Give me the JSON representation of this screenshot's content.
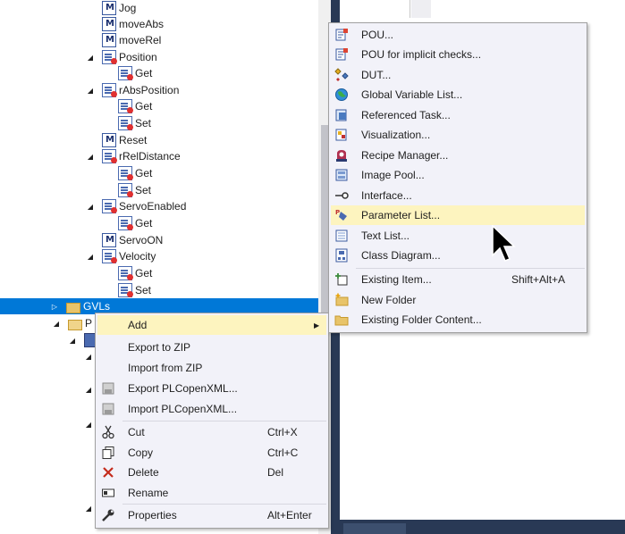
{
  "tree": {
    "items": [
      {
        "label": "Jog",
        "icon": "function-block-icon",
        "arrow": ""
      },
      {
        "label": "moveAbs",
        "icon": "function-block-icon",
        "arrow": ""
      },
      {
        "label": "moveRel",
        "icon": "function-block-icon",
        "arrow": ""
      },
      {
        "label": "Position",
        "icon": "property-icon",
        "arrow": "◢"
      },
      {
        "label": "Get",
        "icon": "property-icon",
        "arrow": ""
      },
      {
        "label": "rAbsPosition",
        "icon": "property-icon",
        "arrow": "◢"
      },
      {
        "label": "Get",
        "icon": "property-icon",
        "arrow": ""
      },
      {
        "label": "Set",
        "icon": "property-icon",
        "arrow": ""
      },
      {
        "label": "Reset",
        "icon": "function-block-icon",
        "arrow": ""
      },
      {
        "label": "rRelDistance",
        "icon": "property-icon",
        "arrow": "◢"
      },
      {
        "label": "Get",
        "icon": "property-icon",
        "arrow": ""
      },
      {
        "label": "Set",
        "icon": "property-icon",
        "arrow": ""
      },
      {
        "label": "ServoEnabled",
        "icon": "property-icon",
        "arrow": "◢"
      },
      {
        "label": "Get",
        "icon": "property-icon",
        "arrow": ""
      },
      {
        "label": "ServoON",
        "icon": "function-block-icon",
        "arrow": ""
      },
      {
        "label": "Velocity",
        "icon": "property-icon",
        "arrow": "◢"
      },
      {
        "label": "Get",
        "icon": "property-icon",
        "arrow": ""
      },
      {
        "label": "Set",
        "icon": "property-icon",
        "arrow": ""
      },
      {
        "label": "GVLs",
        "icon": "folder-icon",
        "arrow": "▷"
      },
      {
        "label": "P",
        "icon": "folder-open-icon",
        "arrow": "◢"
      }
    ]
  },
  "context_menu": {
    "items": [
      {
        "label": "Add",
        "icon": "",
        "shortcut": "",
        "submenu": "▶"
      },
      {
        "label": "Export to ZIP",
        "icon": "",
        "shortcut": ""
      },
      {
        "label": "Import from ZIP",
        "icon": "",
        "shortcut": ""
      },
      {
        "label": "Export PLCopenXML...",
        "icon": "export-xml-icon",
        "shortcut": ""
      },
      {
        "label": "Import PLCopenXML...",
        "icon": "import-xml-icon",
        "shortcut": ""
      },
      {
        "label": "Cut",
        "icon": "scissors-icon",
        "shortcut": "Ctrl+X"
      },
      {
        "label": "Copy",
        "icon": "copy-icon",
        "shortcut": "Ctrl+C"
      },
      {
        "label": "Delete",
        "icon": "delete-x-icon",
        "shortcut": "Del"
      },
      {
        "label": "Rename",
        "icon": "rename-icon",
        "shortcut": ""
      },
      {
        "label": "Properties",
        "icon": "wrench-icon",
        "shortcut": "Alt+Enter"
      }
    ]
  },
  "add_submenu": {
    "items": [
      {
        "label": "POU...",
        "icon": "pou-icon",
        "shortcut": ""
      },
      {
        "label": "POU for implicit checks...",
        "icon": "pou-checks-icon",
        "shortcut": ""
      },
      {
        "label": "DUT...",
        "icon": "dut-icon",
        "shortcut": ""
      },
      {
        "label": "Global Variable List...",
        "icon": "globe-icon",
        "shortcut": ""
      },
      {
        "label": "Referenced Task...",
        "icon": "referenced-task-icon",
        "shortcut": ""
      },
      {
        "label": "Visualization...",
        "icon": "visualization-icon",
        "shortcut": ""
      },
      {
        "label": "Recipe Manager...",
        "icon": "recipe-manager-icon",
        "shortcut": ""
      },
      {
        "label": "Image Pool...",
        "icon": "image-pool-icon",
        "shortcut": ""
      },
      {
        "label": "Interface...",
        "icon": "interface-icon",
        "shortcut": ""
      },
      {
        "label": "Parameter List...",
        "icon": "parameter-list-icon",
        "shortcut": ""
      },
      {
        "label": "Text List...",
        "icon": "text-list-icon",
        "shortcut": ""
      },
      {
        "label": "Class Diagram...",
        "icon": "class-diagram-icon",
        "shortcut": ""
      },
      {
        "label": "Existing Item...",
        "icon": "existing-item-icon",
        "shortcut": "Shift+Alt+A"
      },
      {
        "label": "New Folder",
        "icon": "new-folder-icon",
        "shortcut": ""
      },
      {
        "label": "Existing Folder Content...",
        "icon": "folder-icon",
        "shortcut": ""
      }
    ]
  },
  "colors": {
    "selection": "#0078d7",
    "menu_background": "#f2f2f9",
    "menu_highlight": "#fdf4bf",
    "frame_dark": "#293955"
  }
}
